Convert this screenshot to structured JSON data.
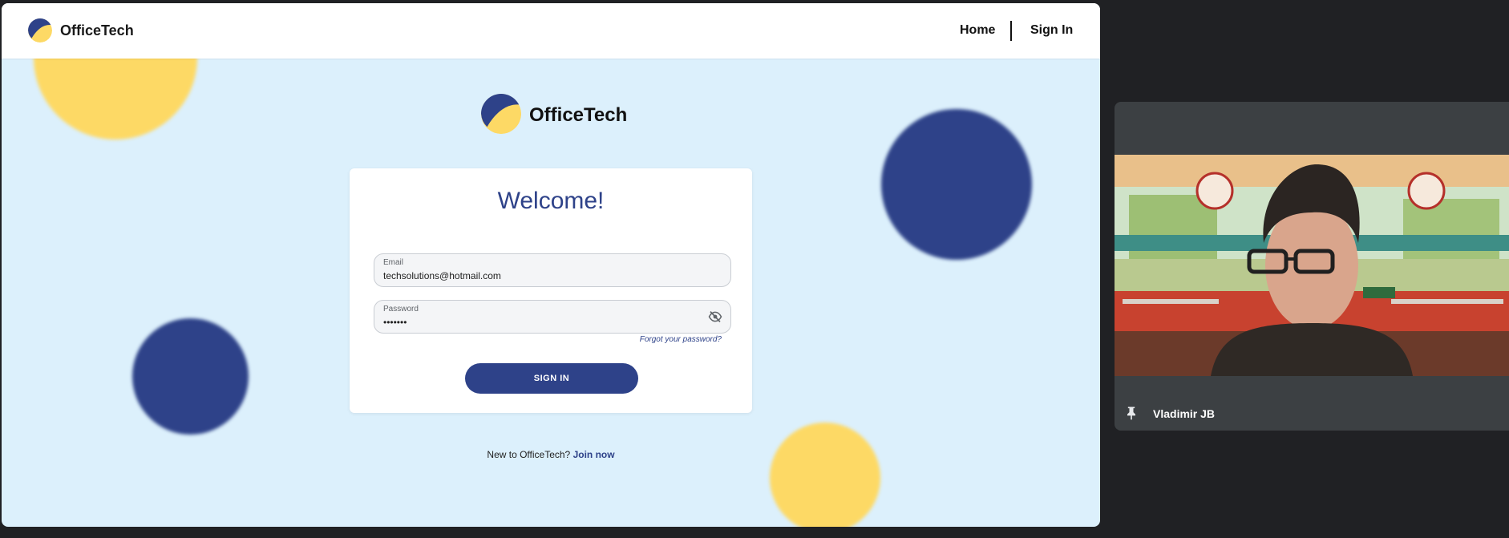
{
  "navbar": {
    "brand": "OfficeTech",
    "home_label": "Home",
    "signin_label": "Sign In"
  },
  "hero": {
    "brand": "OfficeTech"
  },
  "login": {
    "title": "Welcome!",
    "email_label": "Email",
    "email_value": "techsolutions@hotmail.com",
    "password_label": "Password",
    "password_value": "•••••••",
    "forgot_label": "Forgot your password?",
    "submit_label": "SIGN IN"
  },
  "signup": {
    "prompt": "New to OfficeTech?",
    "link_label": "Join now"
  },
  "participant": {
    "name": "Vladimir JB"
  },
  "colors": {
    "brand_navy": "#2e4289",
    "brand_yellow": "#fdd965",
    "page_background": "#dcf0fc",
    "meeting_background": "#202124",
    "tile_background": "#3c4043"
  },
  "icons": {
    "logo": "officetech-logo-icon",
    "password_toggle": "eye-off-icon",
    "pin": "pin-icon"
  }
}
